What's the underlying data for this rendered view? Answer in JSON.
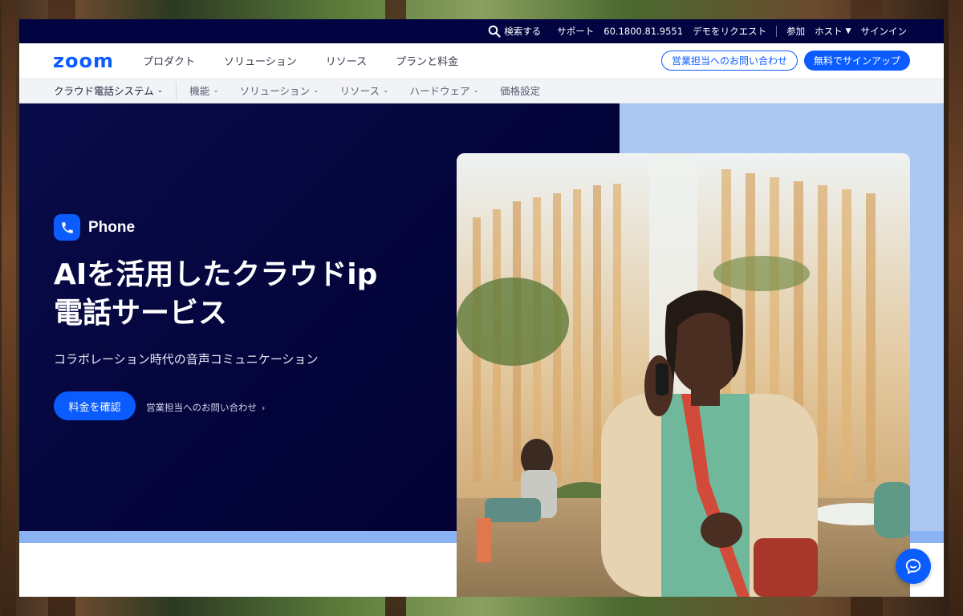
{
  "topbar": {
    "search": "検索する",
    "support": "サポート",
    "phone": "60.1800.81.9551",
    "demo": "デモをリクエスト",
    "join": "参加",
    "host": "ホスト",
    "signin": "サインイン"
  },
  "mainnav": {
    "logo": "zoom",
    "items": [
      "プロダクト",
      "ソリューション",
      "リソース",
      "プランと料金"
    ],
    "contact_sales": "営業担当へのお問い合わせ",
    "signup_free": "無料でサインアップ"
  },
  "subnav": {
    "items": [
      "クラウド電話システム",
      "機能",
      "ソリューション",
      "リソース",
      "ハードウェア",
      "価格設定"
    ]
  },
  "hero": {
    "product_label": "Phone",
    "headline_line1": "AIを活用したクラウドip",
    "headline_line2": "電話サービス",
    "subtitle": "コラボレーション時代の音声コミュニケーション",
    "primary_cta": "料金を確認",
    "secondary_cta": "営業担当へのお問い合わせ"
  },
  "colors": {
    "brand_blue": "#0b5cff",
    "navy": "#020341",
    "light_blue_panel": "#adc7f3",
    "stripe_blue": "#8ab3f4"
  },
  "icons": {
    "search": "search-icon",
    "phone": "phone-icon",
    "chat": "chat-bubble-icon",
    "chevron": "chevron-down-icon",
    "arrow": "chevron-right-icon"
  }
}
